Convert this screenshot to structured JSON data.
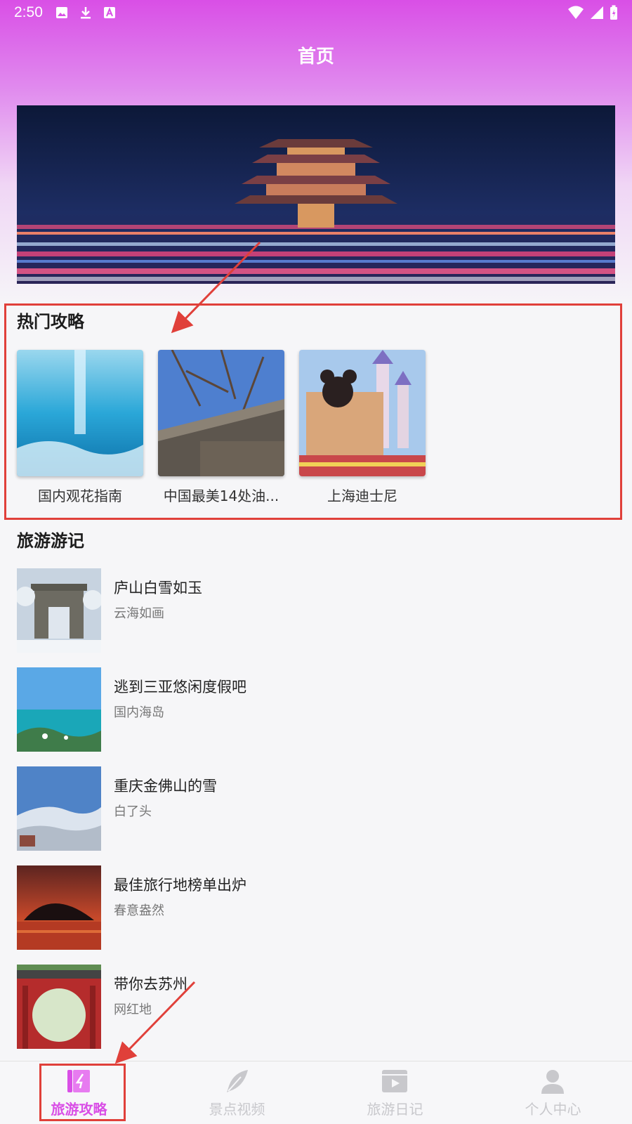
{
  "status_bar": {
    "time": "2:50"
  },
  "header": {
    "title": "首页"
  },
  "hot_section": {
    "title": "热门攻略",
    "items": [
      {
        "label": "国内观花指南"
      },
      {
        "label": "中国最美14处油..."
      },
      {
        "label": "上海迪士尼"
      }
    ]
  },
  "travel_section": {
    "title": "旅游游记",
    "items": [
      {
        "title": "庐山白雪如玉",
        "subtitle": "云海如画"
      },
      {
        "title": "逃到三亚悠闲度假吧",
        "subtitle": "国内海岛"
      },
      {
        "title": "重庆金佛山的雪",
        "subtitle": "白了头"
      },
      {
        "title": "最佳旅行地榜单出炉",
        "subtitle": "春意盎然"
      },
      {
        "title": "带你去苏州",
        "subtitle": "网红地"
      }
    ]
  },
  "bottom_nav": {
    "items": [
      {
        "label": "旅游攻略",
        "icon": "guide-icon",
        "active": true
      },
      {
        "label": "景点视频",
        "icon": "feather-icon",
        "active": false
      },
      {
        "label": "旅游日记",
        "icon": "video-play-icon",
        "active": false
      },
      {
        "label": "个人中心",
        "icon": "person-icon",
        "active": false
      }
    ]
  },
  "colors": {
    "accent": "#d94fe6",
    "annotation": "#e0403a",
    "inactive_nav": "#c8c8cc"
  }
}
